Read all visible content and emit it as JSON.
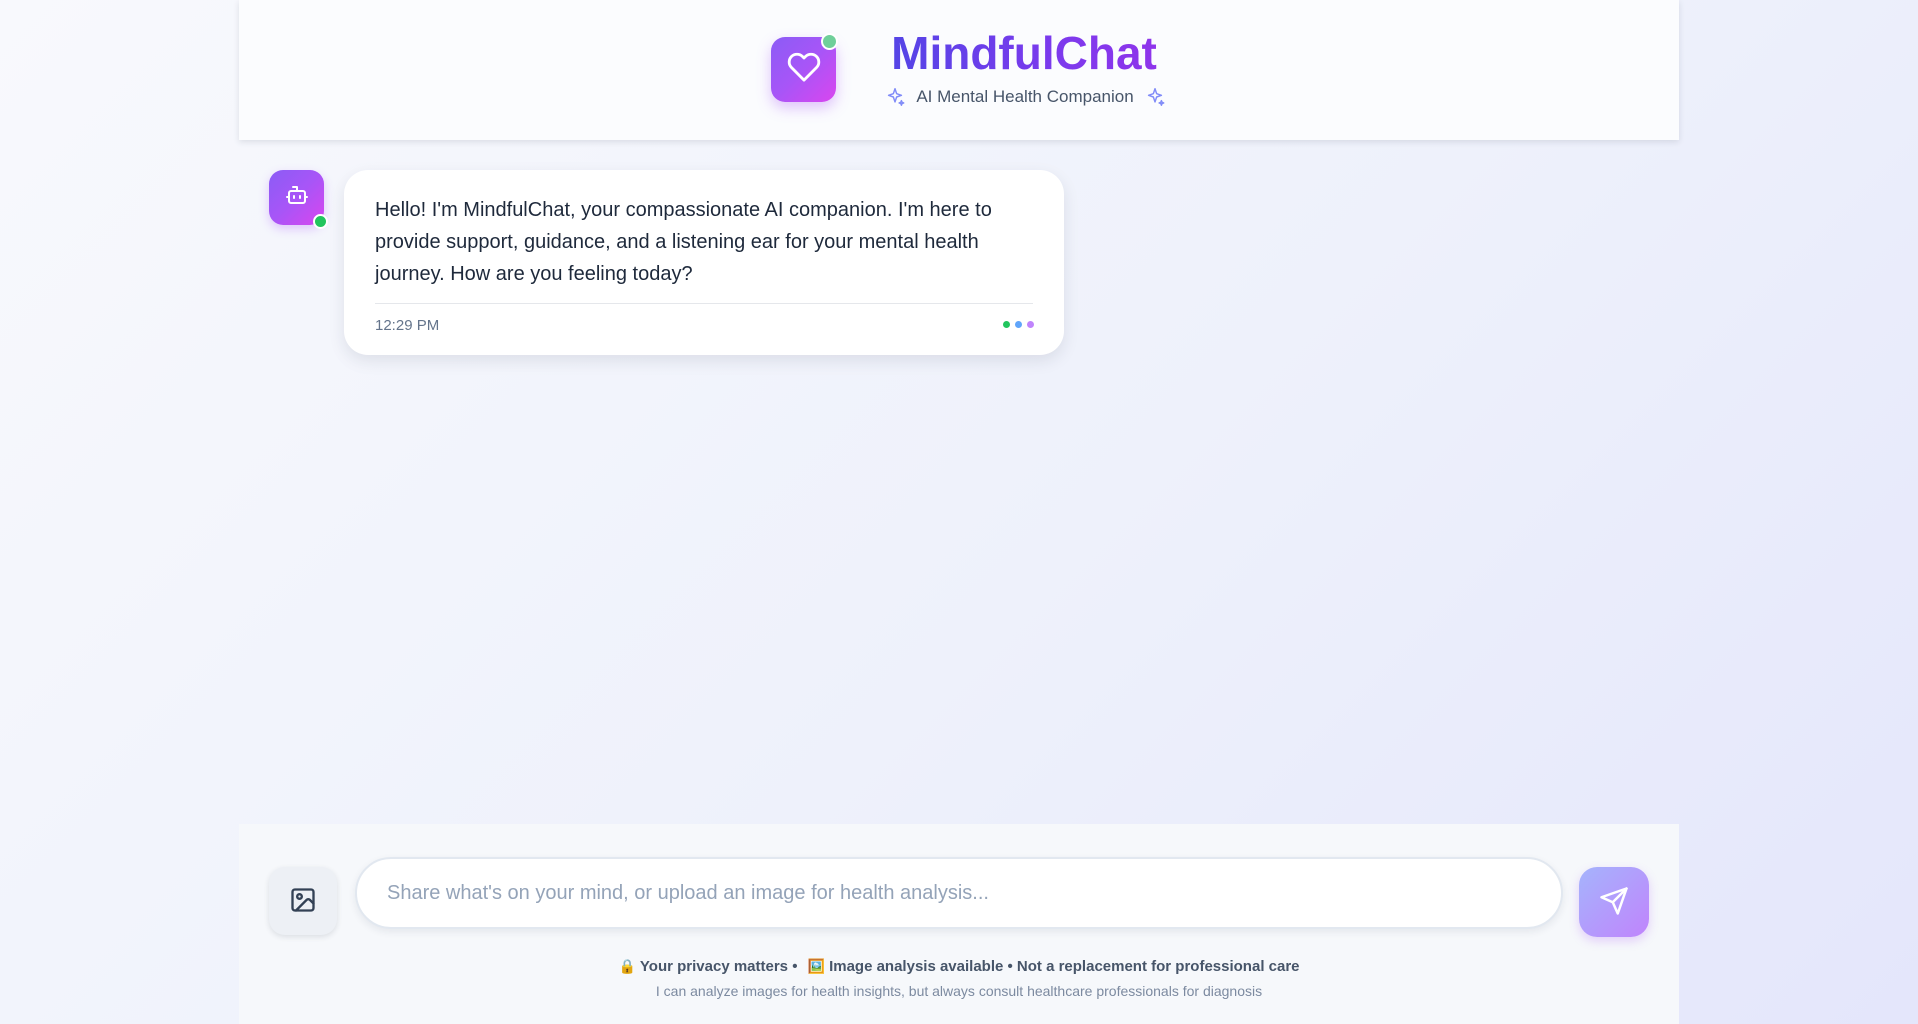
{
  "header": {
    "title": "MindfulChat",
    "subtitle": "AI Mental Health Companion",
    "logo_icon": "heart-icon",
    "sparkle_icon": "sparkle-icon"
  },
  "messages": [
    {
      "sender": "bot",
      "avatar_icon": "robot-icon",
      "text": "Hello! I'm MindfulChat, your compassionate AI companion. I'm here to provide support, guidance, and a listening ear for your mental health journey. How are you feeling today?",
      "time": "12:29 PM",
      "dot_colors": [
        "#22c55e",
        "#60a5fa",
        "#c084fc"
      ]
    }
  ],
  "composer": {
    "placeholder": "Share what's on your mind, or upload an image for health analysis...",
    "value": "",
    "upload_icon": "image-icon",
    "send_icon": "send-icon"
  },
  "footer": {
    "privacy_emoji": "🔒",
    "privacy_text": "Your privacy matters •",
    "image_emoji": "🖼️",
    "image_text": "Image analysis available • Not a replacement for professional care",
    "disclaimer": "I can analyze images for health insights, but always consult healthcare professionals for diagnosis"
  },
  "colors": {
    "brand_start": "#4f46e5",
    "brand_end": "#9333ea",
    "accent_purple": "#a855f7",
    "online_green": "#22c55e"
  }
}
